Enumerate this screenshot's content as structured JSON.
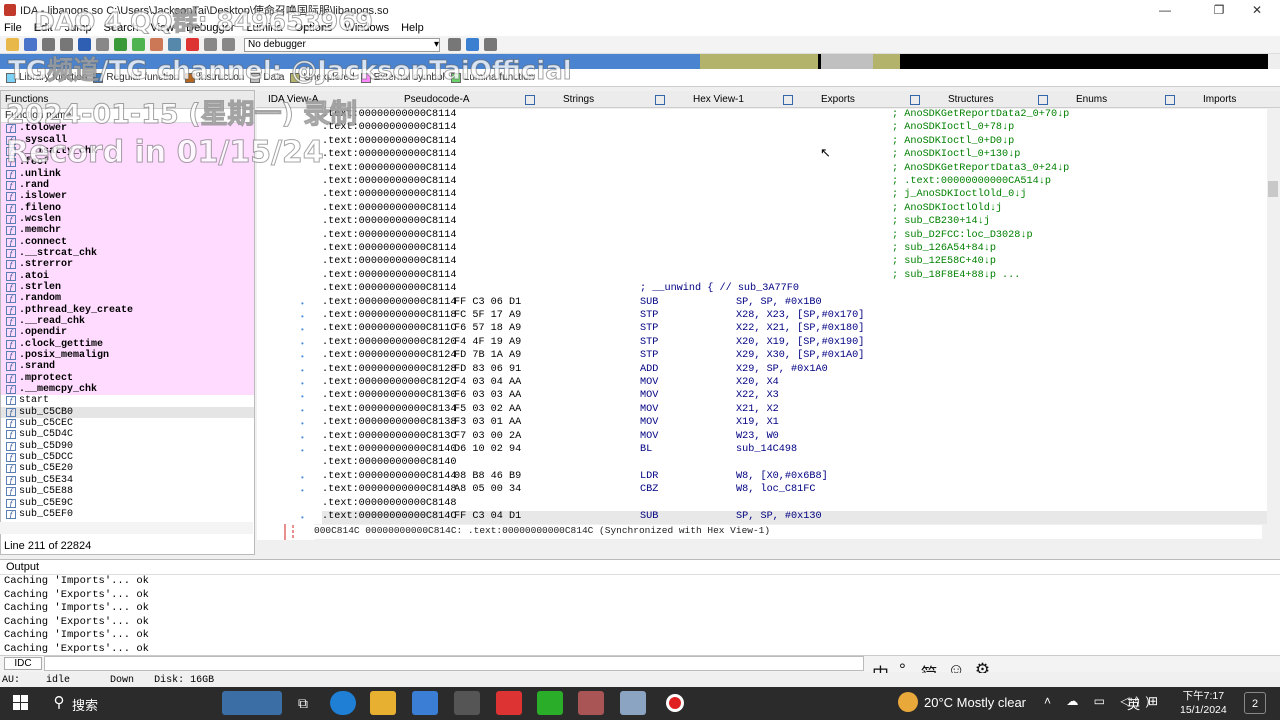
{
  "window": {
    "title": "IDA - libanogs.so C:\\Users\\JacksonTai\\Desktop\\使命召唤国际服\\libanogs.so",
    "minimize": "—",
    "maximize": "❐",
    "close": "✕"
  },
  "menu": [
    "File",
    "Edit",
    "Jump",
    "Search",
    "View",
    "Debugger",
    "Lumina",
    "Options",
    "Windows",
    "Help"
  ],
  "toolbar": {
    "debugger": "No debugger"
  },
  "legend": [
    {
      "label": "Library function",
      "color": "#7bd3f7"
    },
    {
      "label": "Regular function",
      "color": "#3a7ec7"
    },
    {
      "label": "Instruction",
      "color": "#b5651d"
    },
    {
      "label": "Data",
      "color": "#c0c0c0"
    },
    {
      "label": "Unexplored",
      "color": "#b3b36b"
    },
    {
      "label": "External symbol",
      "color": "#ff88ff"
    },
    {
      "label": "Lumina function",
      "color": "#6ad46a"
    }
  ],
  "functions": {
    "header": "Functions",
    "column": "Function name",
    "items": [
      {
        "name": ".tolower",
        "kind": "lib"
      },
      {
        "name": ".syscall",
        "kind": "lib"
      },
      {
        "name": ".__isatty_chk",
        "kind": "lib"
      },
      {
        "name": ".feof",
        "kind": "lib"
      },
      {
        "name": ".unlink",
        "kind": "lib"
      },
      {
        "name": ".rand",
        "kind": "lib"
      },
      {
        "name": ".islower",
        "kind": "lib"
      },
      {
        "name": ".fileno",
        "kind": "lib"
      },
      {
        "name": ".wcslen",
        "kind": "lib"
      },
      {
        "name": ".memchr",
        "kind": "lib"
      },
      {
        "name": ".connect",
        "kind": "lib"
      },
      {
        "name": ".__strcat_chk",
        "kind": "lib"
      },
      {
        "name": ".strerror",
        "kind": "lib"
      },
      {
        "name": ".atoi",
        "kind": "lib"
      },
      {
        "name": ".strlen",
        "kind": "lib"
      },
      {
        "name": ".random",
        "kind": "lib"
      },
      {
        "name": ".pthread_key_create",
        "kind": "lib"
      },
      {
        "name": ".__read_chk",
        "kind": "lib"
      },
      {
        "name": ".opendir",
        "kind": "lib"
      },
      {
        "name": ".clock_gettime",
        "kind": "lib"
      },
      {
        "name": ".posix_memalign",
        "kind": "lib"
      },
      {
        "name": ".srand",
        "kind": "lib"
      },
      {
        "name": ".mprotect",
        "kind": "lib"
      },
      {
        "name": ".__memcpy_chk",
        "kind": "lib"
      },
      {
        "name": "start",
        "kind": "plain"
      },
      {
        "name": "sub_C5CB0",
        "kind": "sel"
      },
      {
        "name": "sub_C5CEC",
        "kind": "plain"
      },
      {
        "name": "sub_C5D4C",
        "kind": "plain"
      },
      {
        "name": "sub_C5D90",
        "kind": "plain"
      },
      {
        "name": "sub_C5DCC",
        "kind": "plain"
      },
      {
        "name": "sub_C5E20",
        "kind": "plain"
      },
      {
        "name": "sub_C5E34",
        "kind": "plain"
      },
      {
        "name": "sub_C5E88",
        "kind": "plain"
      },
      {
        "name": "sub_C5E9C",
        "kind": "plain"
      },
      {
        "name": "sub_C5EF0",
        "kind": "plain"
      }
    ],
    "status": "Line 211 of 22824"
  },
  "tabs": [
    "IDA View-A",
    "Pseudocode-A",
    "Strings",
    "Hex View-1",
    "Exports",
    "Structures",
    "Enums",
    "Imports"
  ],
  "disasm": {
    "lines": [
      {
        "addr": ".text:00000000000C8114",
        "bytes": "",
        "mn": "",
        "ops": "",
        "xref": "; AnoSDKGetReportData2_0+70↓p"
      },
      {
        "addr": ".text:00000000000C8114",
        "bytes": "",
        "mn": "",
        "ops": "",
        "xref": "; AnoSDKIoctl_0+78↓p"
      },
      {
        "addr": ".text:00000000000C8114",
        "bytes": "",
        "mn": "",
        "ops": "",
        "xref": "; AnoSDKIoctl_0+D0↓p"
      },
      {
        "addr": ".text:00000000000C8114",
        "bytes": "",
        "mn": "",
        "ops": "",
        "xref": "; AnoSDKIoctl_0+130↓p"
      },
      {
        "addr": ".text:00000000000C8114",
        "bytes": "",
        "mn": "",
        "ops": "",
        "xref": "; AnoSDKGetReportData3_0+24↓p"
      },
      {
        "addr": ".text:00000000000C8114",
        "bytes": "",
        "mn": "",
        "ops": "",
        "xref": "; .text:00000000000CA514↓p"
      },
      {
        "addr": ".text:00000000000C8114",
        "bytes": "",
        "mn": "",
        "ops": "",
        "xref": "; j_AnoSDKIoctlOld_0↓j"
      },
      {
        "addr": ".text:00000000000C8114",
        "bytes": "",
        "mn": "",
        "ops": "",
        "xref": "; AnoSDKIoctlOld↓j"
      },
      {
        "addr": ".text:00000000000C8114",
        "bytes": "",
        "mn": "",
        "ops": "",
        "xref": "; sub_CB230+14↓j"
      },
      {
        "addr": ".text:00000000000C8114",
        "bytes": "",
        "mn": "",
        "ops": "",
        "xref": "; sub_D2FCC:loc_D3028↓p"
      },
      {
        "addr": ".text:00000000000C8114",
        "bytes": "",
        "mn": "",
        "ops": "",
        "xref": "; sub_126A54+84↓p"
      },
      {
        "addr": ".text:00000000000C8114",
        "bytes": "",
        "mn": "",
        "ops": "",
        "xref": "; sub_12E58C+40↓p"
      },
      {
        "addr": ".text:00000000000C8114",
        "bytes": "",
        "mn": "",
        "ops": "",
        "xref": "; sub_18F8E4+88↓p ..."
      },
      {
        "addr": ".text:00000000000C8114",
        "bytes": "",
        "mn": "; __unwind { // sub_3A77F0",
        "ops": "",
        "xref": ""
      },
      {
        "addr": ".text:00000000000C8114",
        "bytes": "FF C3 06 D1",
        "mn": "SUB",
        "ops": "SP, SP, #0x1B0",
        "xref": ""
      },
      {
        "addr": ".text:00000000000C8118",
        "bytes": "FC 5F 17 A9",
        "mn": "STP",
        "ops": "X28, X23, [SP,#0x170]",
        "xref": ""
      },
      {
        "addr": ".text:00000000000C811C",
        "bytes": "F6 57 18 A9",
        "mn": "STP",
        "ops": "X22, X21, [SP,#0x180]",
        "xref": ""
      },
      {
        "addr": ".text:00000000000C8120",
        "bytes": "F4 4F 19 A9",
        "mn": "STP",
        "ops": "X20, X19, [SP,#0x190]",
        "xref": ""
      },
      {
        "addr": ".text:00000000000C8124",
        "bytes": "FD 7B 1A A9",
        "mn": "STP",
        "ops": "X29, X30, [SP,#0x1A0]",
        "xref": ""
      },
      {
        "addr": ".text:00000000000C8128",
        "bytes": "FD 83 06 91",
        "mn": "ADD",
        "ops": "X29, SP, #0x1A0",
        "xref": ""
      },
      {
        "addr": ".text:00000000000C812C",
        "bytes": "F4 03 04 AA",
        "mn": "MOV",
        "ops": "X20, X4",
        "xref": ""
      },
      {
        "addr": ".text:00000000000C8130",
        "bytes": "F6 03 03 AA",
        "mn": "MOV",
        "ops": "X22, X3",
        "xref": ""
      },
      {
        "addr": ".text:00000000000C8134",
        "bytes": "F5 03 02 AA",
        "mn": "MOV",
        "ops": "X21, X2",
        "xref": ""
      },
      {
        "addr": ".text:00000000000C8138",
        "bytes": "F3 03 01 AA",
        "mn": "MOV",
        "ops": "X19, X1",
        "xref": ""
      },
      {
        "addr": ".text:00000000000C813C",
        "bytes": "F7 03 00 2A",
        "mn": "MOV",
        "ops": "W23, W0",
        "xref": ""
      },
      {
        "addr": ".text:00000000000C8140",
        "bytes": "D6 10 02 94",
        "mn": "BL",
        "ops": "sub_14C498",
        "xref": ""
      },
      {
        "addr": ".text:00000000000C8140",
        "bytes": "",
        "mn": "",
        "ops": "",
        "xref": ""
      },
      {
        "addr": ".text:00000000000C8144",
        "bytes": "08 B8 46 B9",
        "mn": "LDR",
        "ops": "W8, [X0,#0x6B8]",
        "xref": ""
      },
      {
        "addr": ".text:00000000000C8148",
        "bytes": "A8 05 00 34",
        "mn": "CBZ",
        "ops": "W8, loc_C81FC",
        "xref": ""
      },
      {
        "addr": ".text:00000000000C8148",
        "bytes": "",
        "mn": "",
        "ops": "",
        "xref": ""
      },
      {
        "addr": ".text:00000000000C814C",
        "bytes": "FF C3 04 D1",
        "mn": "SUB",
        "ops": "SP, SP, #0x130",
        "xref": "",
        "current": true
      }
    ],
    "status": "000C814C 00000000000C814C: .text:00000000000C814C (Synchronized with Hex View-1)"
  },
  "output": {
    "header": "Output",
    "lines": [
      "Caching 'Imports'... ok",
      "Caching 'Exports'... ok",
      "Caching 'Imports'... ok",
      "Caching 'Exports'... ok",
      "Caching 'Imports'... ok",
      "Caching 'Exports'... ok"
    ],
    "idc": "IDC"
  },
  "ime": [
    "中",
    "°,",
    "简",
    "☺",
    "⚙"
  ],
  "status": {
    "au": "AU:",
    "state": "idle",
    "dir": "Down",
    "disk": "Disk: 16GB"
  },
  "taskbar": {
    "search": "搜索",
    "weather": "20°C  Mostly clear",
    "time": "下午7:17",
    "date": "15/1/2024",
    "ime": "英",
    "notif": "2"
  },
  "watermark": {
    "line1": "DAO 4 QQ群: 849653969",
    "line2": "TG频道/TG channel: @JacksonTaiOfficial",
    "line3": "2024-01-15 (星期一) 录制",
    "line4": "Record in 01/15/24"
  }
}
